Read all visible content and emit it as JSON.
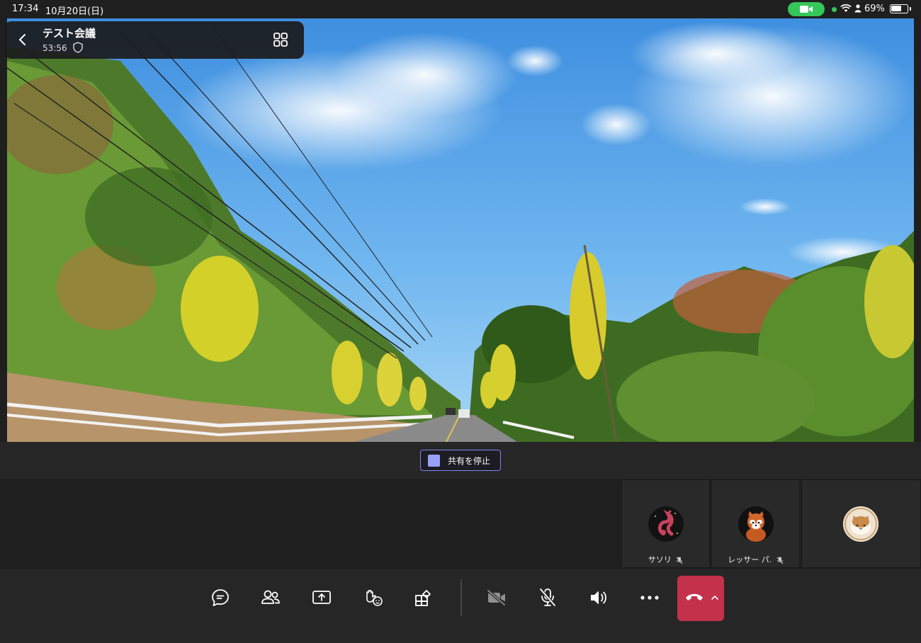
{
  "status_bar": {
    "time": "17:34",
    "date": "10月20日(日)",
    "battery_percent": "69%",
    "battery_level": 0.69,
    "camera_indicator_icon": "video-camera-icon"
  },
  "meeting": {
    "title": "テスト会議",
    "timer": "53:56"
  },
  "share": {
    "stop_label": "共有を停止"
  },
  "participants": [
    {
      "name": "サソリ",
      "muted": true,
      "avatar_icon": "scorpion-avatar"
    },
    {
      "name": "レッサー パ.",
      "muted": true,
      "avatar_icon": "red-panda-avatar"
    },
    {
      "name": "",
      "muted": false,
      "avatar_icon": "cat-avatar"
    }
  ],
  "toolbar": {
    "buttons": [
      {
        "id": "chat",
        "icon": "chat-icon"
      },
      {
        "id": "people",
        "icon": "people-icon"
      },
      {
        "id": "share",
        "icon": "share-screen-icon"
      },
      {
        "id": "react",
        "icon": "raise-hand-react-icon"
      },
      {
        "id": "apps",
        "icon": "apps-icon"
      },
      {
        "id": "camera",
        "icon": "camera-off-icon"
      },
      {
        "id": "mic",
        "icon": "mic-off-icon"
      },
      {
        "id": "speaker",
        "icon": "speaker-icon"
      },
      {
        "id": "more",
        "icon": "more-icon"
      }
    ],
    "hangup_icon": "hang-up-icon"
  },
  "colors": {
    "accent": "#7f85f5",
    "hangup": "#c4314b",
    "status_green": "#34c759",
    "background": "#1f1f1f"
  }
}
